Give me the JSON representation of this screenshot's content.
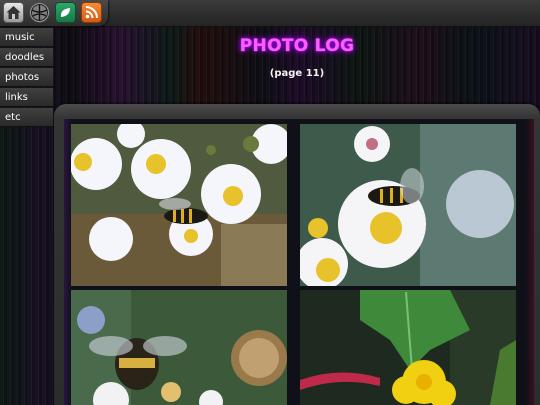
{
  "toolbar": {
    "icons": [
      "home-icon",
      "ball-icon",
      "leaf-icon",
      "rss-icon"
    ]
  },
  "nav": {
    "items": [
      {
        "label": "music"
      },
      {
        "label": "doodles"
      },
      {
        "label": "photos"
      },
      {
        "label": "links"
      },
      {
        "label": "etc"
      }
    ]
  },
  "header": {
    "title": "PHOTO LOG",
    "subtitle": "(page 11)"
  },
  "gallery": {
    "photos": [
      {
        "subject": "hoverfly on white asters"
      },
      {
        "subject": "hoverfly on white aster"
      },
      {
        "subject": "bumblebee on flower"
      },
      {
        "subject": "yellow flower with leaves"
      }
    ]
  },
  "colors": {
    "title_glow": "#ff5cff",
    "nav_bg": "#333333",
    "rss_orange": "#e56f22",
    "leaf_green": "#1f9254"
  }
}
